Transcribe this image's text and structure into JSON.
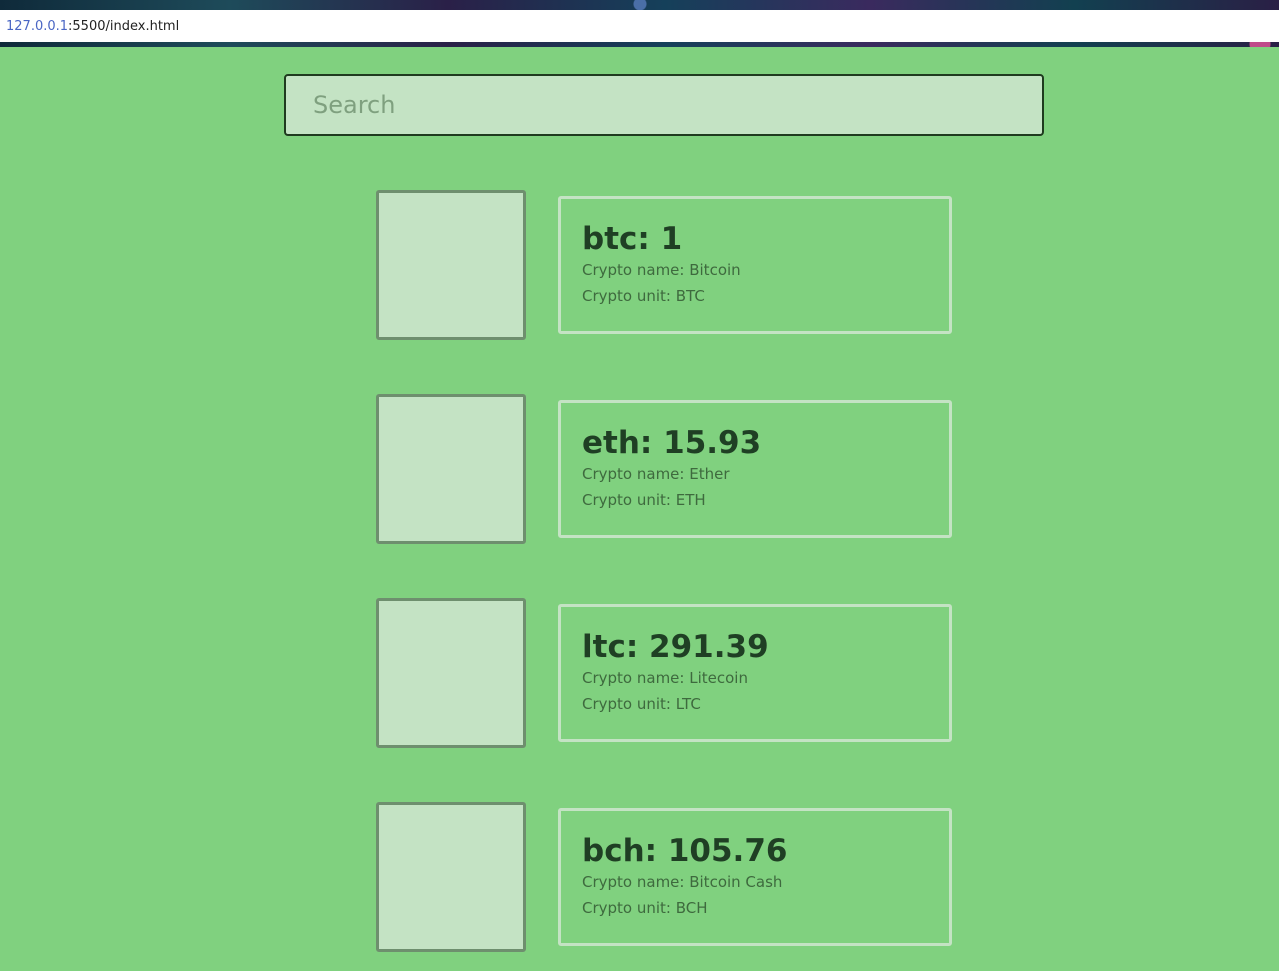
{
  "browser": {
    "url_host": "127.0.0.1",
    "url_rest": ":5500/index.html"
  },
  "search": {
    "placeholder": "Search",
    "value": ""
  },
  "cryptos": [
    {
      "code": "btc",
      "rate": "1",
      "name_label": "Crypto name: Bitcoin",
      "unit_label": "Crypto unit: BTC"
    },
    {
      "code": "eth",
      "rate": "15.93",
      "name_label": "Crypto name: Ether",
      "unit_label": "Crypto unit: ETH"
    },
    {
      "code": "ltc",
      "rate": "291.39",
      "name_label": "Crypto name: Litecoin",
      "unit_label": "Crypto unit: LTC"
    },
    {
      "code": "bch",
      "rate": "105.76",
      "name_label": "Crypto name: Bitcoin Cash",
      "unit_label": "Crypto unit: BCH"
    }
  ],
  "colors": {
    "background": "#80d17f",
    "panel": "#c4e3c4",
    "text_dark": "#1f3f24"
  }
}
